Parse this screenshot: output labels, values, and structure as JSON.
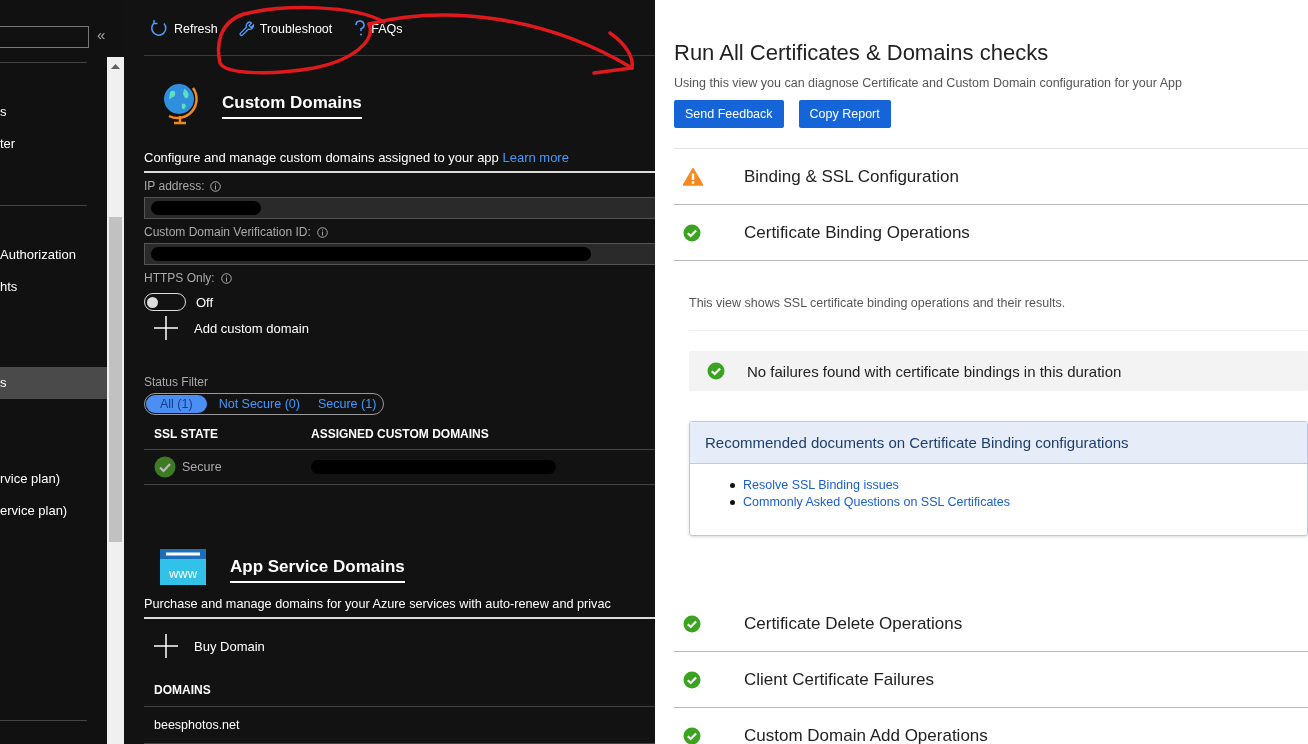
{
  "sidebar": {
    "collapse_glyph": "«",
    "groups": [
      {
        "divider": true,
        "items": [
          {
            "label": "s",
            "selected": false
          },
          {
            "label": "ter",
            "selected": false
          }
        ]
      },
      {
        "divider": true,
        "items": [
          {
            "label": "Authorization",
            "selected": false
          },
          {
            "label": "hts",
            "selected": false
          }
        ]
      },
      {
        "divider": false,
        "items": [
          {
            "label": "s",
            "selected": true
          }
        ]
      },
      {
        "divider": false,
        "items": [
          {
            "label": "rvice plan)",
            "selected": false
          },
          {
            "label": "ervice plan)",
            "selected": false
          }
        ]
      }
    ]
  },
  "toolbar": [
    {
      "kind": "refresh",
      "label": "Refresh"
    },
    {
      "kind": "troubleshoot",
      "label": "Troubleshoot"
    },
    {
      "kind": "faq",
      "label": "FAQs"
    }
  ],
  "custom_domains": {
    "title": "Custom Domains",
    "description": "Configure and manage custom domains assigned to your app",
    "link": "Learn more",
    "fields": [
      {
        "label": "IP address:",
        "redacted": true
      },
      {
        "label": "Custom Domain Verification ID:",
        "redacted": true
      }
    ],
    "https_only": {
      "label": "HTTPS Only:",
      "on": false,
      "state_text": "Off"
    },
    "add_button": "Add custom domain",
    "status_filter": {
      "label": "Status Filter",
      "options": [
        {
          "label": "All (1)",
          "selected": true
        },
        {
          "label": "Not Secure (0)",
          "selected": false
        },
        {
          "label": "Secure (1)",
          "selected": false
        }
      ]
    },
    "table": {
      "columns": [
        "SSL STATE",
        "ASSIGNED CUSTOM DOMAINS"
      ],
      "rows": [
        {
          "ssl_state": "Secure",
          "domain_redacted": true
        }
      ]
    }
  },
  "app_service_domains": {
    "icon_text": "www",
    "title": "App Service Domains",
    "description": "Purchase and manage domains for your Azure services with auto-renew and privac",
    "buy_button": "Buy Domain",
    "table": {
      "columns": [
        "DOMAINS"
      ],
      "rows": [
        "beesphotos.net"
      ]
    }
  },
  "diagnostics": {
    "title": "Run All Certificates & Domains checks",
    "subtitle": "Using this view you can diagnose Certificate and Custom Domain configuration for your App",
    "buttons": [
      "Send Feedback",
      "Copy Report"
    ],
    "checks": [
      {
        "kind": "warning",
        "label": "Binding & SSL Configuration"
      },
      {
        "kind": "success",
        "label": "Certificate Binding Operations",
        "details": {
          "description": "This view shows SSL certificate binding operations and their results.",
          "result": {
            "kind": "success",
            "message": "No failures found with certificate bindings in this duration"
          },
          "documents": {
            "title": "Recommended documents on Certificate Binding configurations",
            "links": [
              "Resolve SSL Binding issues",
              "Commonly Asked Questions on SSL Certificates"
            ]
          }
        }
      },
      {
        "kind": "success",
        "label": "Certificate Delete Operations"
      },
      {
        "kind": "success",
        "label": "Client Certificate Failures"
      },
      {
        "kind": "success",
        "label": "Custom Domain Add Operations"
      }
    ]
  }
}
